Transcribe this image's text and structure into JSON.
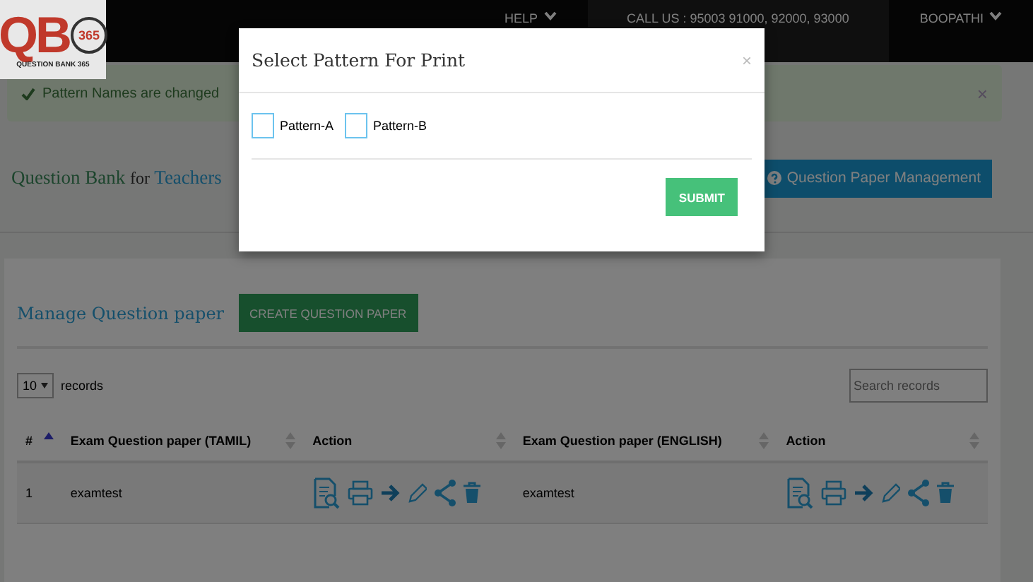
{
  "logo": {
    "mark": "QB",
    "badge": "365",
    "tagline": "QUESTION BANK 365"
  },
  "nav": [
    {
      "label": "HELP",
      "caret": true,
      "selected": false
    },
    {
      "label": "CALL US : 95003 91000, 92000, 93000",
      "caret": false,
      "selected": true
    },
    {
      "label": "BOOPATHI",
      "caret": true,
      "selected": false
    }
  ],
  "alert": {
    "message": "Pattern Names are changed",
    "close": "×"
  },
  "page_title": {
    "part_1": "Question Bank",
    "part_2": "for",
    "part_3": "Teachers"
  },
  "management_button": "Question Paper Management",
  "card": {
    "title": "Manage Question paper",
    "create_button": "CREATE QUESTION PAPER",
    "page_size": "10",
    "page_size_label": "records",
    "search": {
      "placeholder": "Search records"
    },
    "table": {
      "columns": [
        {
          "label": "#",
          "sorted": true
        },
        {
          "label": "Exam Question paper (TAMIL)",
          "sorted": false
        },
        {
          "label": "Action",
          "sorted": false
        },
        {
          "label": "Exam Question paper (ENGLISH)",
          "sorted": false
        },
        {
          "label": "Action",
          "sorted": false
        }
      ],
      "rows": [
        {
          "number": "1",
          "tamil": "examtest",
          "english": "examtest"
        }
      ]
    }
  },
  "modal": {
    "title": "Select Pattern For Print",
    "close": "×",
    "options": [
      {
        "label": "Pattern-A",
        "checked": false
      },
      {
        "label": "Pattern-B",
        "checked": false
      }
    ],
    "submit": "SUBMIT"
  }
}
